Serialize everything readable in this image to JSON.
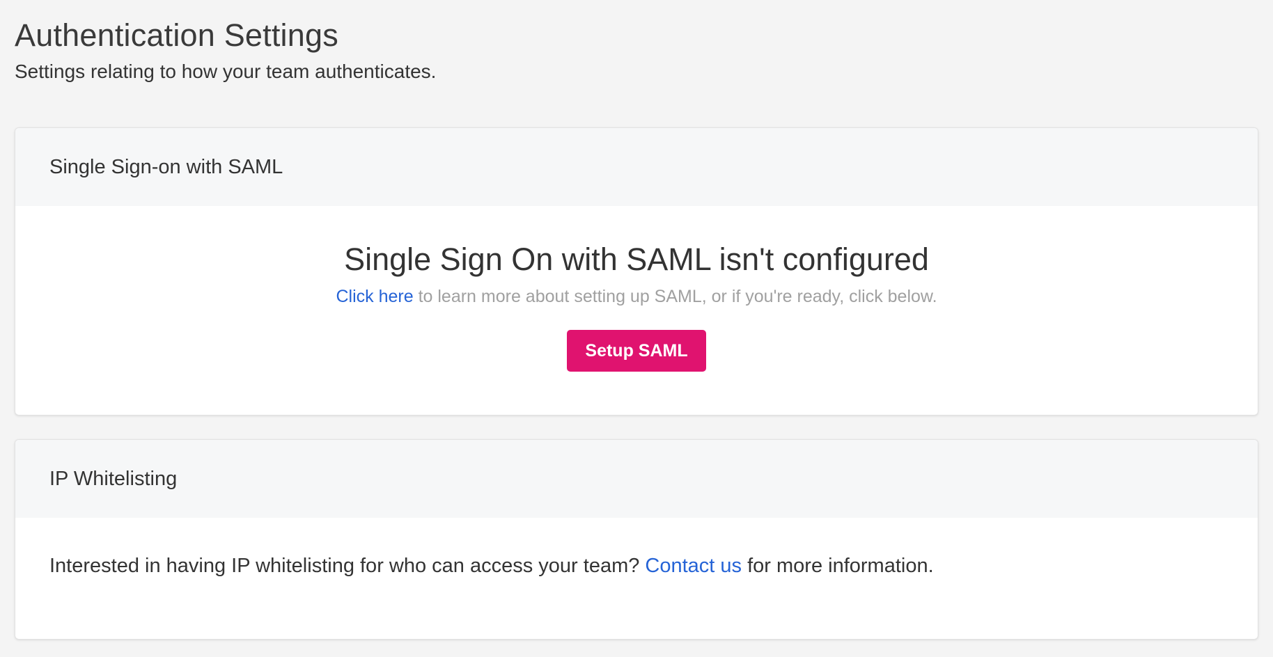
{
  "page": {
    "title": "Authentication Settings",
    "subtitle": "Settings relating to how your team authenticates."
  },
  "saml": {
    "header": "Single Sign-on with SAML",
    "heading": "Single Sign On with SAML isn't configured",
    "link_text": "Click here",
    "description_rest": " to learn more about setting up SAML, or if you're ready, click below.",
    "button_label": "Setup SAML"
  },
  "ip_whitelisting": {
    "header": "IP Whitelisting",
    "text_before": "Interested in having IP whitelisting for who can access your team? ",
    "link_text": "Contact us",
    "text_after": " for more information."
  },
  "colors": {
    "accent": "#e0136f",
    "link": "#2563d6",
    "background": "#f4f4f4",
    "card_header": "#f6f7f8"
  }
}
